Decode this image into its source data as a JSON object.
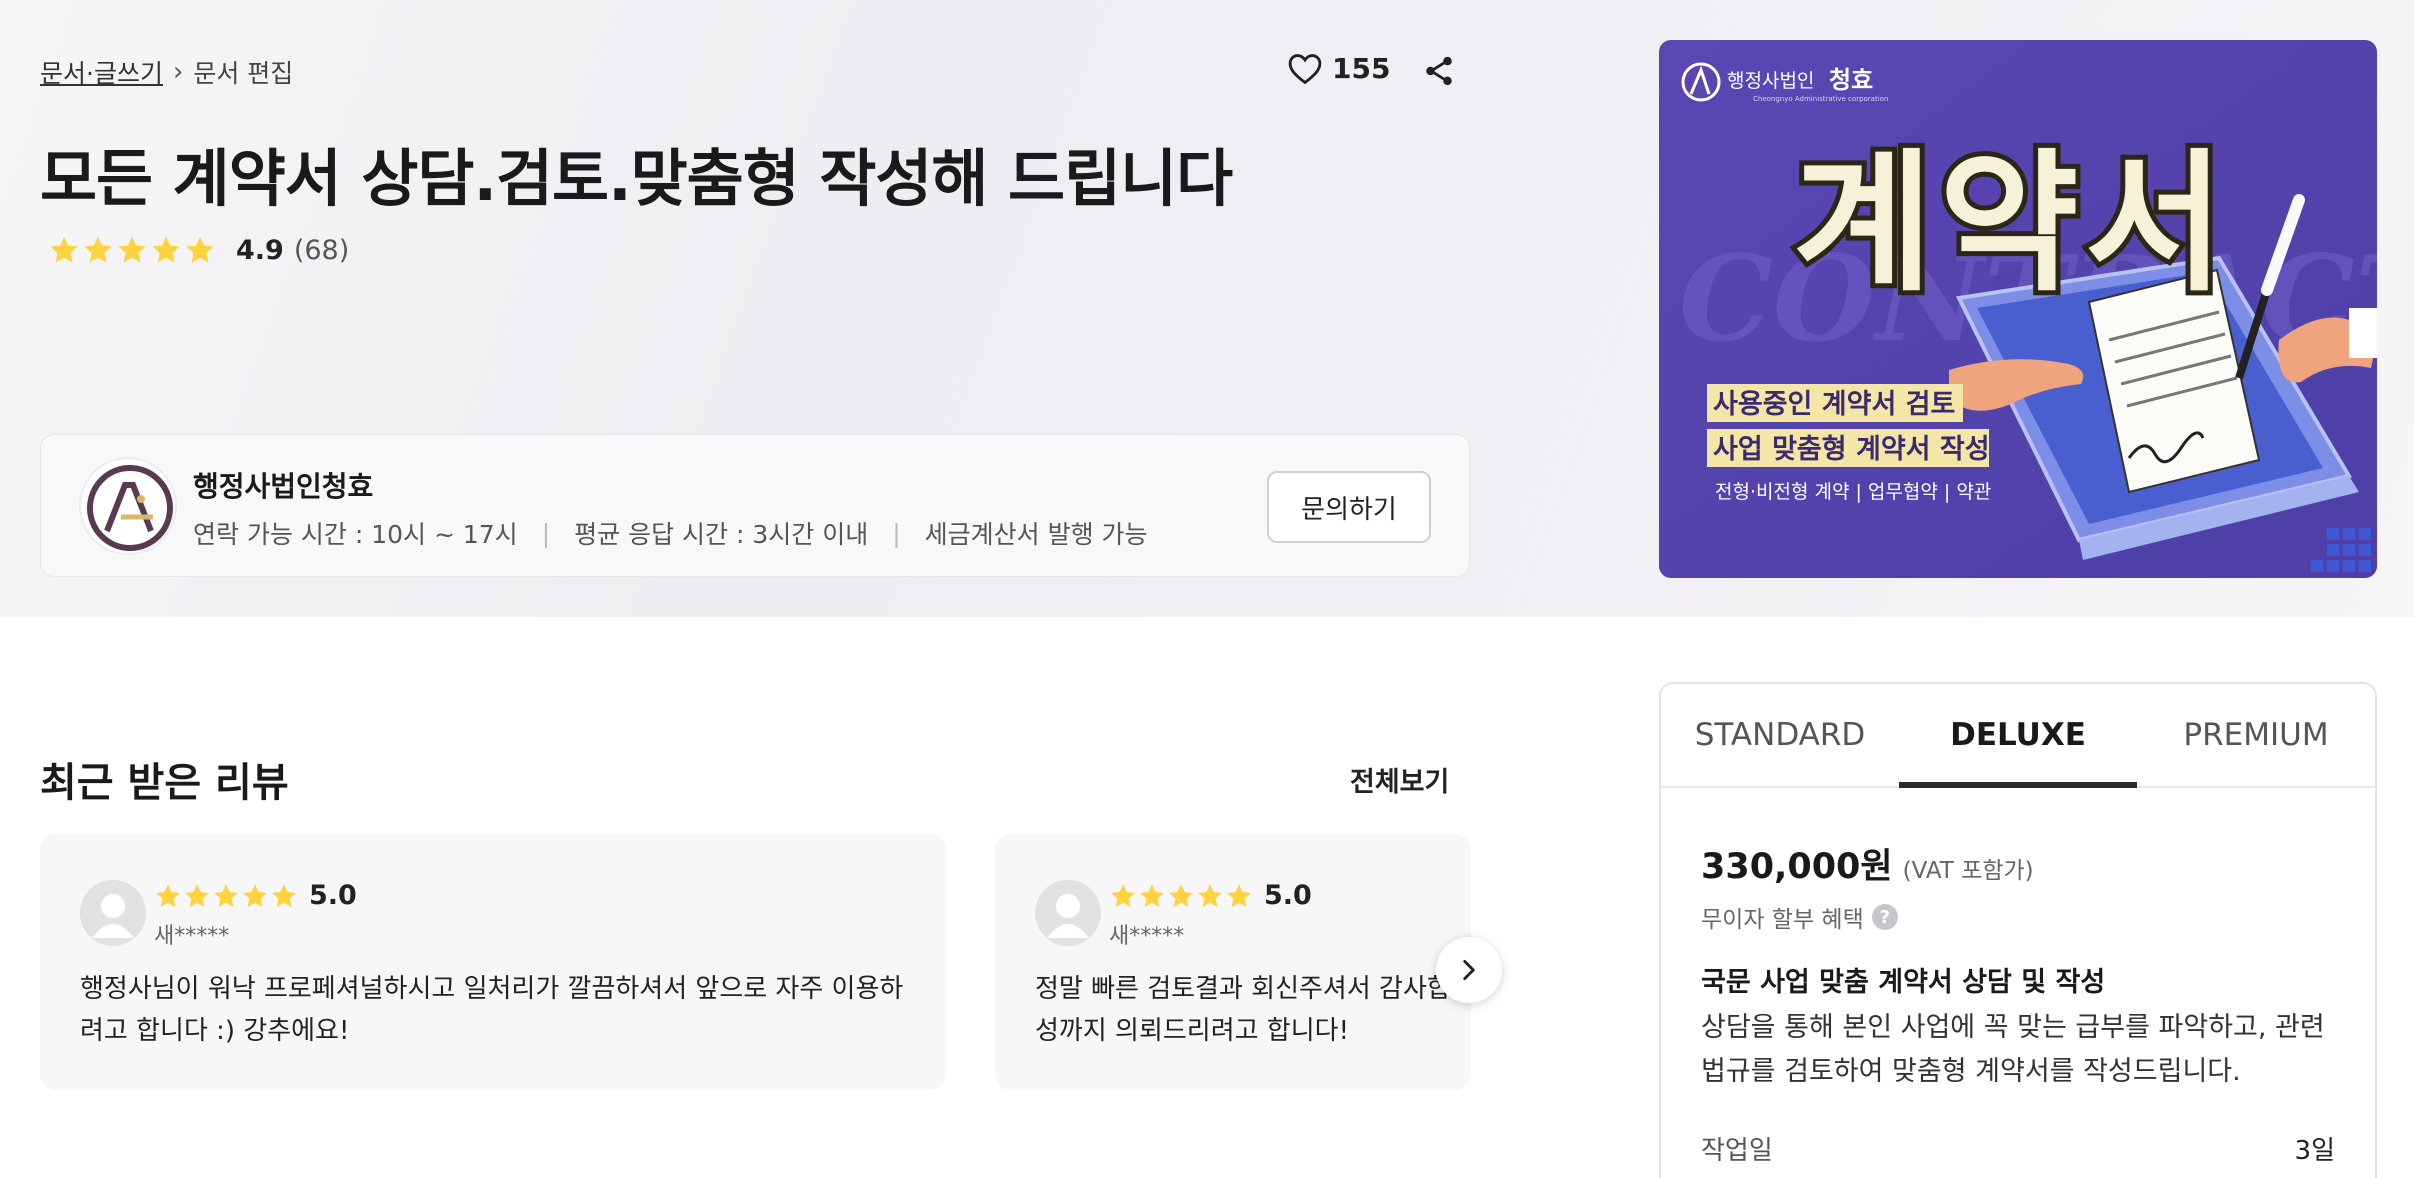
{
  "breadcrumb": {
    "category": "문서·글쓰기",
    "subcategory": "문서 편집"
  },
  "likes": {
    "count": "155"
  },
  "title": "모든 계약서 상담.검토.맞춤형 작성해 드립니다",
  "rating": {
    "score": "4.9",
    "count": "(68)",
    "stars": 5
  },
  "seller": {
    "name": "행정사법인청효",
    "contact_hours": "연락 가능 시간 : 10시 ~ 17시",
    "avg_response": "평균 응답 시간 : 3시간 이내",
    "invoice": "세금계산서 발행 가능",
    "inquire_label": "문의하기"
  },
  "banner": {
    "brand": "행정사법인",
    "brand_bold": "청효",
    "brand_sub": "Cheongnyo Administrative corporation",
    "main": "계약서",
    "bg_word": "CONTRACT",
    "line1": "사용중인 계약서 검토",
    "line2": "사업 맞춤형 계약서 작성",
    "line3": "전형·비전형 계약 | 업무협약 | 약관",
    "colors": {
      "bg": "#5746b0",
      "highlight": "#f4e6a6",
      "text": "#f6f2d8"
    }
  },
  "reviews": {
    "section_title": "최근 받은 리뷰",
    "see_all": "전체보기",
    "items": [
      {
        "score": "5.0",
        "user": "새*****",
        "text": "행정사님이 워낙 프로페셔널하시고 일처리가 깔끔하셔서 앞으로 자주 이용하려고 합니다 :) 강추에요!"
      },
      {
        "score": "5.0",
        "user": "새*****",
        "text_line1": "정말 빠른 검토결과 회신주셔서 감사합니다.",
        "text_line2": "성까지 의뢰드리려고 합니다!"
      }
    ]
  },
  "package": {
    "tabs": [
      "STANDARD",
      "DELUXE",
      "PREMIUM"
    ],
    "active_tab": "DELUXE",
    "price": "330,000원",
    "vat": "(VAT 포함가)",
    "installment": "무이자 할부 혜택",
    "heading": "국문 사업 맞춤 계약서 상담 및 작성",
    "description": "상담을 통해 본인 사업에 꼭 맞는 급부를 파악하고, 관련 법규를 검토하여 맞춤형 계약서를 작성드립니다.",
    "work_label": "작업일",
    "work_value": "3일"
  },
  "colors": {
    "star": "#ffd23f",
    "accent_dark": "#2a2a2e"
  }
}
